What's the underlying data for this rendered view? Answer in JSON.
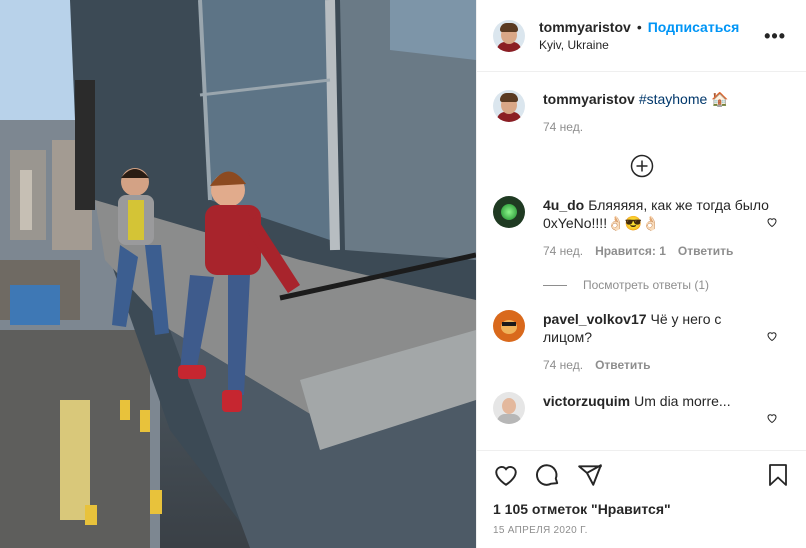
{
  "header": {
    "username": "tommyaristov",
    "separator": "•",
    "follow_label": "Подписаться",
    "location": "Kyiv, Ukraine",
    "more_label": "•••"
  },
  "caption": {
    "username": "tommyaristov",
    "hashtag": "#stayhome",
    "emoji": "🏠",
    "time": "74 нед."
  },
  "load_more_icon": "plus-circle-icon",
  "comments": [
    {
      "username": "4u_do",
      "text": "Бляяяяя, как же тогда было 0xYeNo!!!!👌🏻😎👌🏻",
      "time": "74 нед.",
      "likes": "Нравится: 1",
      "reply": "Ответить",
      "view_replies": "Посмотреть ответы (1)"
    },
    {
      "username": "pavel_volkov17",
      "text": "Чё у него с лицом?",
      "time": "74 нед.",
      "reply": "Ответить"
    },
    {
      "username": "victorzuquim",
      "text": "Um dia morre..."
    }
  ],
  "actions": {
    "like_icon": "heart-icon",
    "comment_icon": "comment-icon",
    "share_icon": "share-icon",
    "save_icon": "bookmark-icon",
    "likes_text": "1 105 отметок \"Нравится\"",
    "date": "15 АПРЕЛЯ 2020 Г."
  },
  "colors": {
    "follow": "#0095f6",
    "secondary_text": "#8e8e8e",
    "hashtag": "#00376b"
  }
}
